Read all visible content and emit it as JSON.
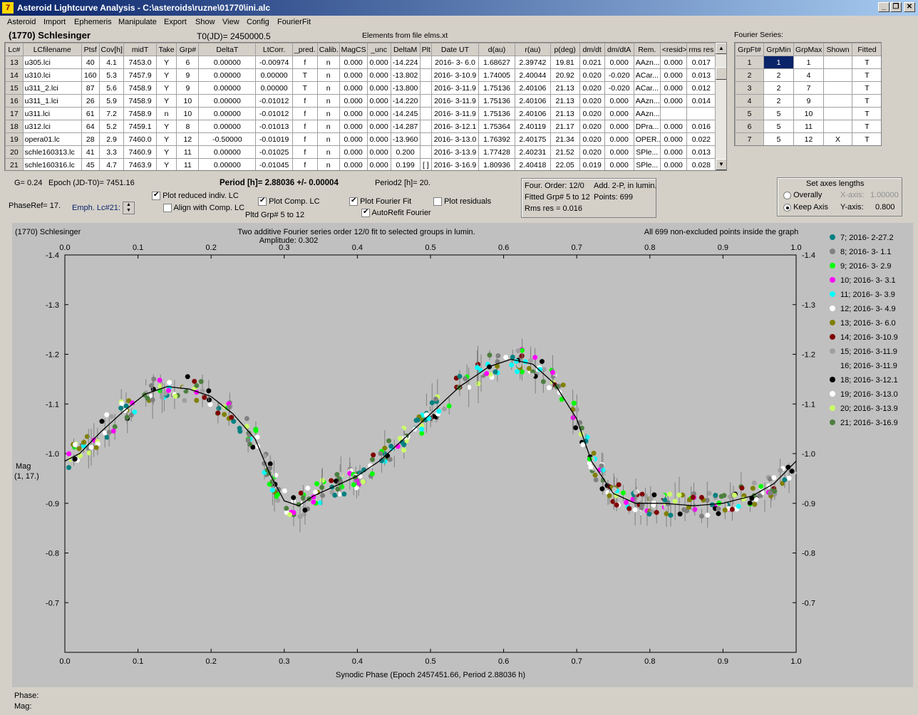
{
  "window": {
    "title": "Asteroid Lightcurve Analysis - C:\\asteroids\\ruzne\\01770\\ini.alc",
    "app_icon": "7",
    "min": "_",
    "max": "\b",
    "close": "✕"
  },
  "menu": [
    "Asteroid",
    "Import",
    "Ephemeris",
    "Manipulate",
    "Export",
    "Show",
    "View",
    "Config",
    "FourierFit"
  ],
  "header": {
    "name": "(1770) Schlesinger",
    "t0": "T0(JD)= 2450000.5",
    "elements": "Elements from file elms.xt",
    "fourier_title": "Fourier Series:"
  },
  "lc_table": {
    "columns": [
      "Lc#",
      "LCfilename",
      "Ptsf",
      "Cov[h]",
      "midT",
      "Take",
      "Grp#",
      "DeltaT",
      "LtCorr.",
      "_pred.",
      "Calib.",
      "MagCS",
      "_unc",
      "DeltaM",
      "Plt",
      "Date UT",
      "d(au)",
      "r(au)",
      "p(deg)",
      "dm/dt",
      "dm/dtA",
      "Rem.",
      "<resid>",
      "rms res"
    ],
    "rows": [
      [
        "13",
        "u305.lci",
        "40",
        "4.1",
        "7453.0",
        "Y",
        "6",
        "0.00000",
        "-0.00974",
        "f",
        "n",
        "0.000",
        "0.000",
        "-14.224",
        "",
        "2016- 3- 6.0",
        "1.68627",
        "2.39742",
        "19.81",
        "0.021",
        "0.000",
        "AAzn...",
        "0.000",
        "0.017"
      ],
      [
        "14",
        "u310.lci",
        "160",
        "5.3",
        "7457.9",
        "Y",
        "9",
        "0.00000",
        "0.00000",
        "T",
        "n",
        "0.000",
        "0.000",
        "-13.802",
        "",
        "2016- 3-10.9",
        "1.74005",
        "2.40044",
        "20.92",
        "0.020",
        "-0.020",
        "ACar...",
        "0.000",
        "0.013"
      ],
      [
        "15",
        "u311_2.lci",
        "87",
        "5.6",
        "7458.9",
        "Y",
        "9",
        "0.00000",
        "0.00000",
        "T",
        "n",
        "0.000",
        "0.000",
        "-13.800",
        "",
        "2016- 3-11.9",
        "1.75136",
        "2.40106",
        "21.13",
        "0.020",
        "-0.020",
        "ACar...",
        "0.000",
        "0.012"
      ],
      [
        "16",
        "u311_1.lci",
        "26",
        "5.9",
        "7458.9",
        "Y",
        "10",
        "0.00000",
        "-0.01012",
        "f",
        "n",
        "0.000",
        "0.000",
        "-14.220",
        "",
        "2016- 3-11.9",
        "1.75136",
        "2.40106",
        "21.13",
        "0.020",
        "0.000",
        "AAzn...",
        "0.000",
        "0.014"
      ],
      [
        "17",
        "u311.lci",
        "61",
        "7.2",
        "7458.9",
        "n",
        "10",
        "0.00000",
        "-0.01012",
        "f",
        "n",
        "0.000",
        "0.000",
        "-14.245",
        "",
        "2016- 3-11.9",
        "1.75136",
        "2.40106",
        "21.13",
        "0.020",
        "0.000",
        "AAzn...",
        "",
        ""
      ],
      [
        "18",
        "u312.lci",
        "64",
        "5.2",
        "7459.1",
        "Y",
        "8",
        "0.00000",
        "-0.01013",
        "f",
        "n",
        "0.000",
        "0.000",
        "-14.287",
        "",
        "2016- 3-12.1",
        "1.75364",
        "2.40119",
        "21.17",
        "0.020",
        "0.000",
        "DPra...",
        "0.000",
        "0.016"
      ],
      [
        "19",
        "opera01.lc",
        "28",
        "2.9",
        "7460.0",
        "Y",
        "12",
        "-0.50000",
        "-0.01019",
        "f",
        "n",
        "0.000",
        "0.000",
        "-13.960",
        "",
        "2016- 3-13.0",
        "1.76392",
        "2.40175",
        "21.34",
        "0.020",
        "0.000",
        "OPER...",
        "0.000",
        "0.022"
      ],
      [
        "20",
        "schle160313.lc",
        "41",
        "3.3",
        "7460.9",
        "Y",
        "11",
        "0.00000",
        "-0.01025",
        "f",
        "n",
        "0.000",
        "0.000",
        "0.200",
        "",
        "2016- 3-13.9",
        "1.77428",
        "2.40231",
        "21.52",
        "0.020",
        "0.000",
        "SPle...",
        "0.000",
        "0.013"
      ],
      [
        "21",
        "schle160316.lc",
        "45",
        "4.7",
        "7463.9",
        "Y",
        "11",
        "0.00000",
        "-0.01045",
        "f",
        "n",
        "0.000",
        "0.000",
        "0.199",
        "[ ]",
        "2016- 3-16.9",
        "1.80936",
        "2.40418",
        "22.05",
        "0.019",
        "0.000",
        "SPle...",
        "0.000",
        "0.028"
      ]
    ]
  },
  "fourier_table": {
    "columns": [
      "GrpFt#",
      "GrpMin",
      "GrpMax",
      "Shown",
      "Fitted"
    ],
    "rows": [
      [
        "1",
        "1",
        "1",
        "",
        "T"
      ],
      [
        "2",
        "2",
        "4",
        "",
        "T"
      ],
      [
        "3",
        "2",
        "7",
        "",
        "T"
      ],
      [
        "4",
        "2",
        "9",
        "",
        "T"
      ],
      [
        "5",
        "5",
        "10",
        "",
        "T"
      ],
      [
        "6",
        "5",
        "11",
        "",
        "T"
      ],
      [
        "7",
        "5",
        "12",
        "X",
        "T"
      ]
    ]
  },
  "info": {
    "g": "G= 0.24",
    "epoch": "Epoch (JD-T0)= 7451.16",
    "period": "Period [h]= 2.88036 +/- 0.00004",
    "period2": "Period2 [h]= 20.",
    "phaseref": "PhaseRef= 17.",
    "emph": "Emph. Lc#21:",
    "plot_reduced": "Plot reduced indiv. LC",
    "align": "Align with Comp. LC",
    "plot_comp": "Plot Comp. LC",
    "pltd_grp": "Pltd Grp#  5  to  12",
    "plot_fourier": "Plot Fourier Fit",
    "autorefit": "AutoRefit Fourier",
    "plot_resid": "Plot residuals",
    "four_order": "Four. Order: 12/0",
    "add2p": "Add. 2-P, in lumin.",
    "fitted_grp": "Fitted Grp# 5 to 12",
    "points": "Points: 699",
    "rms": "Rms res      = 0.016",
    "axes_title": "Set axes lengths",
    "overally": "Overally",
    "keep_axis": "Keep Axis",
    "xaxis_lbl": "X-axis:",
    "xaxis_val": "1.00000",
    "yaxis_lbl": "Y-axis:",
    "yaxis_val": "0.800"
  },
  "plot_labels": {
    "object": "(1770) Schlesinger",
    "desc1": "Two additive Fourier series order 12/0 fit to selected groups in lumin.",
    "desc2": "Amplitude: 0.302",
    "note": "All 699 non-excluded points inside the graph",
    "ylabel1": "Mag",
    "ylabel2": "(1, 17.)",
    "xlabel": "Synodic Phase (Epoch 2457451.66, Period 2.88036 h)"
  },
  "chart_data": {
    "type": "scatter",
    "xlim": [
      0.0,
      1.0
    ],
    "ylim": [
      -1.4,
      -0.6
    ],
    "y_reversed": true,
    "xticks": [
      "0.0",
      "0.1",
      "0.2",
      "0.3",
      "0.4",
      "0.5",
      "0.6",
      "0.7",
      "0.8",
      "0.9",
      "1.0"
    ],
    "yticks": [
      "-1.4",
      "-1.3",
      "-1.2",
      "-1.1",
      "-1.0",
      "-0.9",
      "-0.8",
      "-0.7"
    ],
    "fit_curve": [
      [
        0.0,
        -0.985
      ],
      [
        0.02,
        -1.0
      ],
      [
        0.05,
        -1.045
      ],
      [
        0.08,
        -1.085
      ],
      [
        0.11,
        -1.12
      ],
      [
        0.14,
        -1.135
      ],
      [
        0.17,
        -1.13
      ],
      [
        0.2,
        -1.115
      ],
      [
        0.23,
        -1.08
      ],
      [
        0.26,
        -1.03
      ],
      [
        0.28,
        -0.96
      ],
      [
        0.3,
        -0.905
      ],
      [
        0.32,
        -0.895
      ],
      [
        0.34,
        -0.915
      ],
      [
        0.37,
        -0.935
      ],
      [
        0.4,
        -0.955
      ],
      [
        0.43,
        -0.985
      ],
      [
        0.46,
        -1.025
      ],
      [
        0.5,
        -1.08
      ],
      [
        0.54,
        -1.135
      ],
      [
        0.58,
        -1.175
      ],
      [
        0.61,
        -1.19
      ],
      [
        0.64,
        -1.18
      ],
      [
        0.67,
        -1.14
      ],
      [
        0.7,
        -1.07
      ],
      [
        0.72,
        -0.985
      ],
      [
        0.75,
        -0.92
      ],
      [
        0.78,
        -0.9
      ],
      [
        0.82,
        -0.9
      ],
      [
        0.86,
        -0.895
      ],
      [
        0.9,
        -0.9
      ],
      [
        0.94,
        -0.915
      ],
      [
        0.97,
        -0.94
      ],
      [
        1.0,
        -0.985
      ]
    ],
    "series": [
      {
        "name": "7; 2016- 2-27.2",
        "color": "#008080"
      },
      {
        "name": "8; 2016- 3- 1.1",
        "color": "#808080"
      },
      {
        "name": "9; 2016- 3- 2.9",
        "color": "#00ff00"
      },
      {
        "name": "10; 2016- 3- 3.1",
        "color": "#ff00ff"
      },
      {
        "name": "11; 2016- 3- 3.9",
        "color": "#00ffff"
      },
      {
        "name": "12; 2016- 3- 4.9",
        "color": "#ffffff"
      },
      {
        "name": "13; 2016- 3- 6.0",
        "color": "#808000"
      },
      {
        "name": "14; 2016- 3-10.9",
        "color": "#800000"
      },
      {
        "name": "15; 2016- 3-11.9",
        "color": "#a0a0a0"
      },
      {
        "name": "16; 2016- 3-11.9",
        "color": "#c0c0c0"
      },
      {
        "name": "18; 2016- 3-12.1",
        "color": "#000000"
      },
      {
        "name": "19; 2016- 3-13.0",
        "color": "#ffffff"
      },
      {
        "name": "20; 2016- 3-13.9",
        "color": "#ccff66"
      },
      {
        "name": "21; 2016- 3-16.9",
        "color": "#4d7f3f"
      }
    ]
  },
  "status": {
    "phase": "Phase:",
    "mag": "Mag:"
  }
}
